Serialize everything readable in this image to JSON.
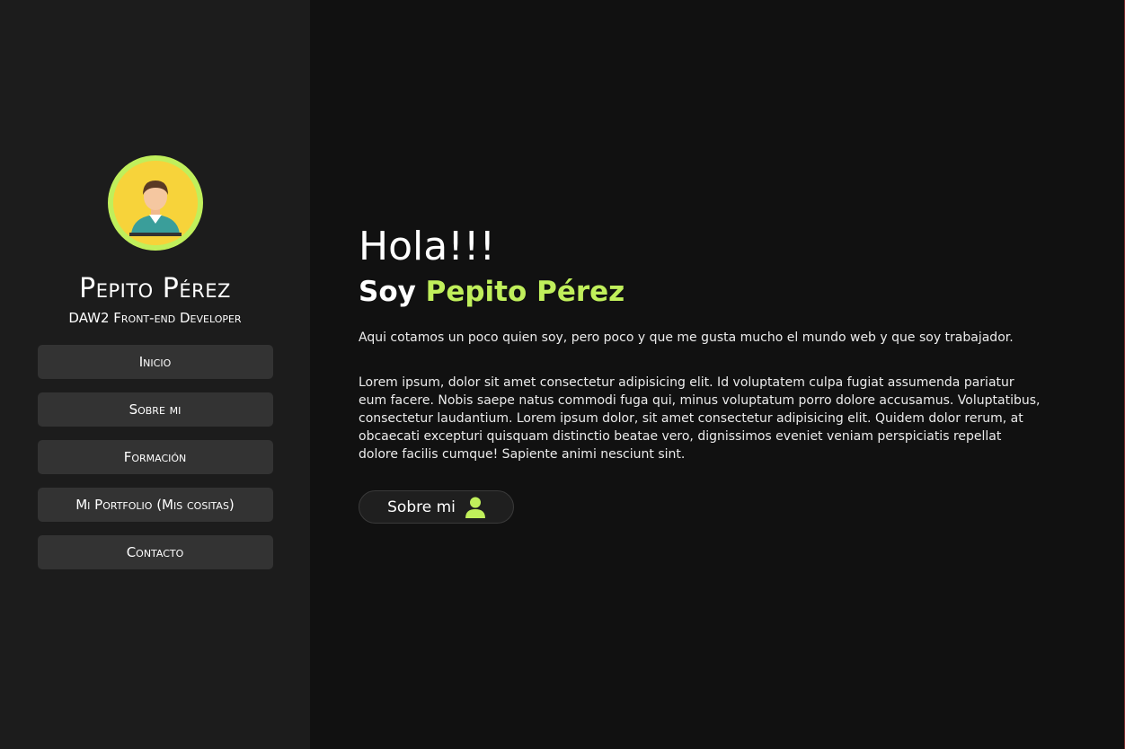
{
  "sidebar": {
    "avatar": {
      "icon": "person-avatar-icon",
      "ring_color": "#c0ef5b",
      "bg_color": "#f7d33a"
    },
    "name": "Pepito Pérez",
    "role": "DAW2 Front-end Developer",
    "nav": [
      {
        "label": "Inicio"
      },
      {
        "label": "Sobre mi"
      },
      {
        "label": "Formación"
      },
      {
        "label": "Mi Portfolio (Mis cositas)"
      },
      {
        "label": "Contacto"
      }
    ]
  },
  "main": {
    "greeting": "Hola!!!",
    "subtitle_prefix": "Soy ",
    "subtitle_name": "Pepito Pérez",
    "intro": "Aqui cotamos un poco quien soy, pero poco y que me gusta mucho el mundo web y que soy trabajador.",
    "lorem": "Lorem ipsum, dolor sit amet consectetur adipisicing elit. Id voluptatem culpa fugiat assumenda pariatur eum facere. Nobis saepe natus commodi fuga qui, minus voluptatum porro dolore accusamus. Voluptatibus, consectetur laudantium. Lorem ipsum dolor, sit amet consectetur adipisicing elit. Quidem dolor rerum, at obcaecati excepturi quisquam distinctio beatae vero, dignissimos eveniet veniam perspiciatis repellat dolore facilis cumque! Sapiente animi nesciunt sint.",
    "cta": {
      "label": "Sobre mi",
      "icon": "user-icon"
    }
  },
  "colors": {
    "accent": "#c0ef5b",
    "sidebar_bg": "#1c1c1c",
    "page_bg": "#111111",
    "button_bg": "#333333"
  }
}
